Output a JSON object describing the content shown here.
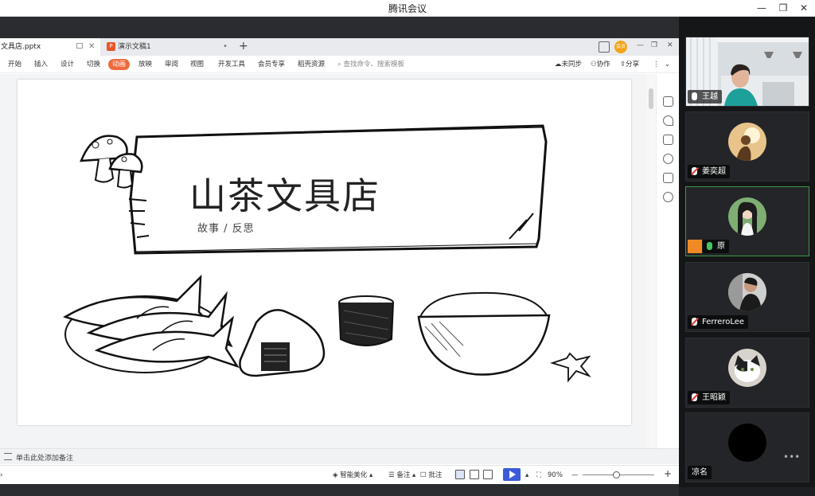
{
  "window": {
    "title": "腾讯会议",
    "minimize": "—",
    "restore": "❐",
    "close": "✕"
  },
  "wps": {
    "tabs": [
      {
        "label": "文具店.pptx",
        "active": true
      },
      {
        "label": "演示文稿1",
        "active": false
      }
    ],
    "new_tab": "+",
    "avatar_badge": "会员",
    "ribbon": {
      "items": [
        "开始",
        "插入",
        "设计",
        "切换",
        "动画",
        "放映",
        "审阅",
        "视图",
        "开发工具",
        "会员专享",
        "稻壳资源"
      ],
      "active": "动画",
      "search_placeholder": "查找命令、搜索模板",
      "right": [
        "未同步",
        "协作",
        "分享"
      ]
    },
    "slide": {
      "title": "山茶文具店",
      "subtitle": "故事 / 反思"
    },
    "notes_placeholder": "单击此处添加备注",
    "status": {
      "beautify": "智能美化",
      "notes": "备注",
      "comments": "批注",
      "zoom": "90%",
      "zoom_minus": "—",
      "zoom_plus": "+"
    }
  },
  "participants": [
    {
      "name": "王越",
      "mic": "on",
      "video": true,
      "speaking": false
    },
    {
      "name": "姜奕超",
      "mic": "muted",
      "video": false,
      "speaking": false
    },
    {
      "name": "原",
      "mic": "on",
      "video": false,
      "speaking": true,
      "host": true
    },
    {
      "name": "FerreroLee",
      "mic": "muted",
      "video": false,
      "speaking": false
    },
    {
      "name": "王昭颖",
      "mic": "muted",
      "video": false,
      "speaking": false
    },
    {
      "name": "凉名",
      "mic": "none",
      "video": false,
      "speaking": false
    }
  ],
  "colors": {
    "accent_orange": "#ef6a3b",
    "speaking_border": "#3a9a4a",
    "muted_red": "#e53935",
    "play_blue": "#3b5bdb"
  }
}
